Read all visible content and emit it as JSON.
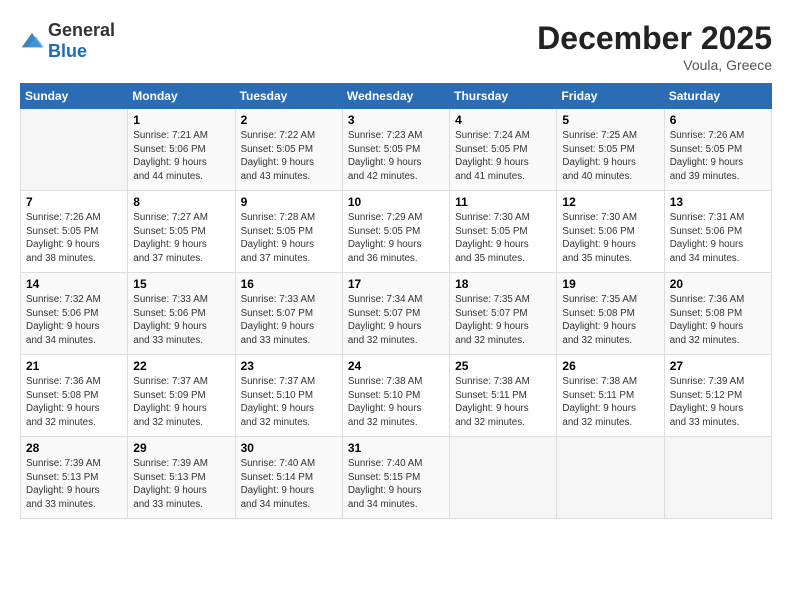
{
  "header": {
    "logo_general": "General",
    "logo_blue": "Blue",
    "month_title": "December 2025",
    "location": "Voula, Greece"
  },
  "weekdays": [
    "Sunday",
    "Monday",
    "Tuesday",
    "Wednesday",
    "Thursday",
    "Friday",
    "Saturday"
  ],
  "weeks": [
    [
      {
        "day": "",
        "info": ""
      },
      {
        "day": "1",
        "info": "Sunrise: 7:21 AM\nSunset: 5:06 PM\nDaylight: 9 hours\nand 44 minutes."
      },
      {
        "day": "2",
        "info": "Sunrise: 7:22 AM\nSunset: 5:05 PM\nDaylight: 9 hours\nand 43 minutes."
      },
      {
        "day": "3",
        "info": "Sunrise: 7:23 AM\nSunset: 5:05 PM\nDaylight: 9 hours\nand 42 minutes."
      },
      {
        "day": "4",
        "info": "Sunrise: 7:24 AM\nSunset: 5:05 PM\nDaylight: 9 hours\nand 41 minutes."
      },
      {
        "day": "5",
        "info": "Sunrise: 7:25 AM\nSunset: 5:05 PM\nDaylight: 9 hours\nand 40 minutes."
      },
      {
        "day": "6",
        "info": "Sunrise: 7:26 AM\nSunset: 5:05 PM\nDaylight: 9 hours\nand 39 minutes."
      }
    ],
    [
      {
        "day": "7",
        "info": "Sunrise: 7:26 AM\nSunset: 5:05 PM\nDaylight: 9 hours\nand 38 minutes."
      },
      {
        "day": "8",
        "info": "Sunrise: 7:27 AM\nSunset: 5:05 PM\nDaylight: 9 hours\nand 37 minutes."
      },
      {
        "day": "9",
        "info": "Sunrise: 7:28 AM\nSunset: 5:05 PM\nDaylight: 9 hours\nand 37 minutes."
      },
      {
        "day": "10",
        "info": "Sunrise: 7:29 AM\nSunset: 5:05 PM\nDaylight: 9 hours\nand 36 minutes."
      },
      {
        "day": "11",
        "info": "Sunrise: 7:30 AM\nSunset: 5:05 PM\nDaylight: 9 hours\nand 35 minutes."
      },
      {
        "day": "12",
        "info": "Sunrise: 7:30 AM\nSunset: 5:06 PM\nDaylight: 9 hours\nand 35 minutes."
      },
      {
        "day": "13",
        "info": "Sunrise: 7:31 AM\nSunset: 5:06 PM\nDaylight: 9 hours\nand 34 minutes."
      }
    ],
    [
      {
        "day": "14",
        "info": "Sunrise: 7:32 AM\nSunset: 5:06 PM\nDaylight: 9 hours\nand 34 minutes."
      },
      {
        "day": "15",
        "info": "Sunrise: 7:33 AM\nSunset: 5:06 PM\nDaylight: 9 hours\nand 33 minutes."
      },
      {
        "day": "16",
        "info": "Sunrise: 7:33 AM\nSunset: 5:07 PM\nDaylight: 9 hours\nand 33 minutes."
      },
      {
        "day": "17",
        "info": "Sunrise: 7:34 AM\nSunset: 5:07 PM\nDaylight: 9 hours\nand 32 minutes."
      },
      {
        "day": "18",
        "info": "Sunrise: 7:35 AM\nSunset: 5:07 PM\nDaylight: 9 hours\nand 32 minutes."
      },
      {
        "day": "19",
        "info": "Sunrise: 7:35 AM\nSunset: 5:08 PM\nDaylight: 9 hours\nand 32 minutes."
      },
      {
        "day": "20",
        "info": "Sunrise: 7:36 AM\nSunset: 5:08 PM\nDaylight: 9 hours\nand 32 minutes."
      }
    ],
    [
      {
        "day": "21",
        "info": "Sunrise: 7:36 AM\nSunset: 5:08 PM\nDaylight: 9 hours\nand 32 minutes."
      },
      {
        "day": "22",
        "info": "Sunrise: 7:37 AM\nSunset: 5:09 PM\nDaylight: 9 hours\nand 32 minutes."
      },
      {
        "day": "23",
        "info": "Sunrise: 7:37 AM\nSunset: 5:10 PM\nDaylight: 9 hours\nand 32 minutes."
      },
      {
        "day": "24",
        "info": "Sunrise: 7:38 AM\nSunset: 5:10 PM\nDaylight: 9 hours\nand 32 minutes."
      },
      {
        "day": "25",
        "info": "Sunrise: 7:38 AM\nSunset: 5:11 PM\nDaylight: 9 hours\nand 32 minutes."
      },
      {
        "day": "26",
        "info": "Sunrise: 7:38 AM\nSunset: 5:11 PM\nDaylight: 9 hours\nand 32 minutes."
      },
      {
        "day": "27",
        "info": "Sunrise: 7:39 AM\nSunset: 5:12 PM\nDaylight: 9 hours\nand 33 minutes."
      }
    ],
    [
      {
        "day": "28",
        "info": "Sunrise: 7:39 AM\nSunset: 5:13 PM\nDaylight: 9 hours\nand 33 minutes."
      },
      {
        "day": "29",
        "info": "Sunrise: 7:39 AM\nSunset: 5:13 PM\nDaylight: 9 hours\nand 33 minutes."
      },
      {
        "day": "30",
        "info": "Sunrise: 7:40 AM\nSunset: 5:14 PM\nDaylight: 9 hours\nand 34 minutes."
      },
      {
        "day": "31",
        "info": "Sunrise: 7:40 AM\nSunset: 5:15 PM\nDaylight: 9 hours\nand 34 minutes."
      },
      {
        "day": "",
        "info": ""
      },
      {
        "day": "",
        "info": ""
      },
      {
        "day": "",
        "info": ""
      }
    ]
  ]
}
